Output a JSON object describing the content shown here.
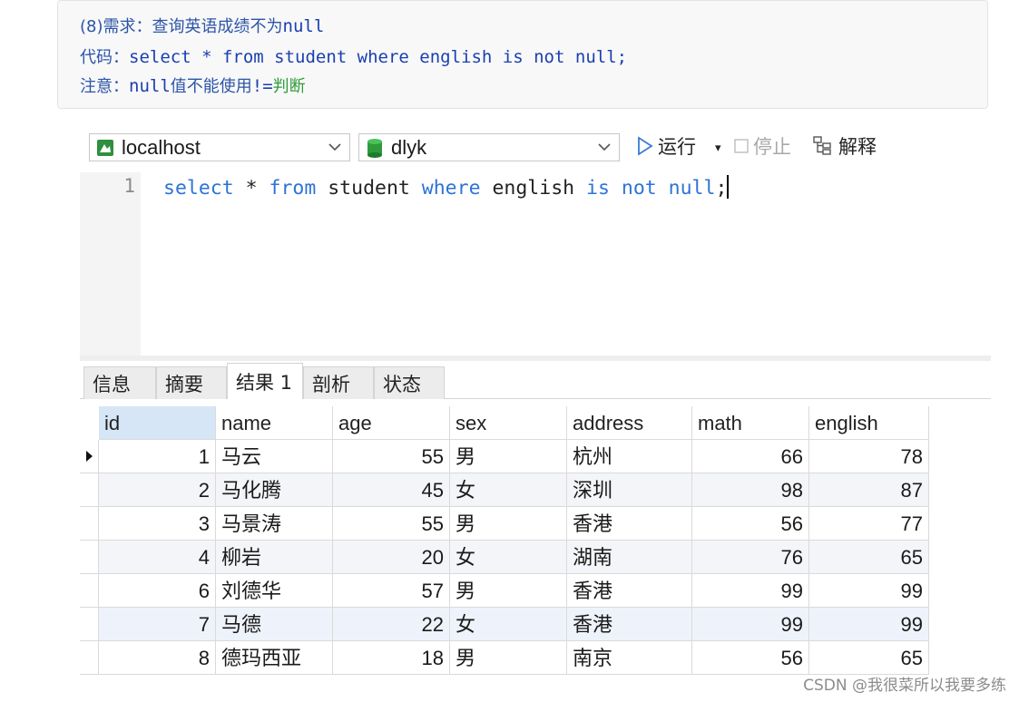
{
  "note": {
    "line1_prefix": "(8)需求：查询英语成绩不为",
    "line1_code": "null",
    "line2_prefix": "代码：",
    "line2_code": "select * from student where english is not null;",
    "line3_prefix": "注意：",
    "line3_code": "null",
    "line3_mid": "值不能使用",
    "line3_code2": "!=",
    "line3_suffix": "判断"
  },
  "toolbar": {
    "connection": "localhost",
    "database": "dlyk",
    "run_label": "运行",
    "run_dropdown": "▾",
    "stop_label": "停止",
    "explain_label": "解释"
  },
  "editor": {
    "line_number": "1",
    "tokens": [
      {
        "text": "select",
        "kw": true
      },
      {
        "text": " * ",
        "kw": false
      },
      {
        "text": "from",
        "kw": true
      },
      {
        "text": " student ",
        "kw": false
      },
      {
        "text": "where",
        "kw": true
      },
      {
        "text": " english ",
        "kw": false
      },
      {
        "text": "is",
        "kw": true
      },
      {
        "text": " ",
        "kw": false
      },
      {
        "text": "not",
        "kw": true
      },
      {
        "text": " ",
        "kw": false
      },
      {
        "text": "null",
        "kw": true
      },
      {
        "text": ";",
        "kw": false
      }
    ]
  },
  "tabs": [
    "信息",
    "摘要",
    "结果 1",
    "剖析",
    "状态"
  ],
  "active_tab": 2,
  "table": {
    "columns": [
      "id",
      "name",
      "age",
      "sex",
      "address",
      "math",
      "english"
    ],
    "rows": [
      [
        "1",
        "马云",
        "55",
        "男",
        "杭州",
        "66",
        "78"
      ],
      [
        "2",
        "马化腾",
        "45",
        "女",
        "深圳",
        "98",
        "87"
      ],
      [
        "3",
        "马景涛",
        "55",
        "男",
        "香港",
        "56",
        "77"
      ],
      [
        "4",
        "柳岩",
        "20",
        "女",
        "湖南",
        "76",
        "65"
      ],
      [
        "6",
        "刘德华",
        "57",
        "男",
        "香港",
        "99",
        "99"
      ],
      [
        "7",
        "马德",
        "22",
        "女",
        "香港",
        "99",
        "99"
      ],
      [
        "8",
        "德玛西亚",
        "18",
        "男",
        "南京",
        "56",
        "65"
      ]
    ]
  },
  "watermark": "CSDN @我很菜所以我要多练",
  "colors": {
    "keyword": "#2c74d6",
    "note_text": "#2b55a8",
    "note_green": "#2e9d3a"
  }
}
